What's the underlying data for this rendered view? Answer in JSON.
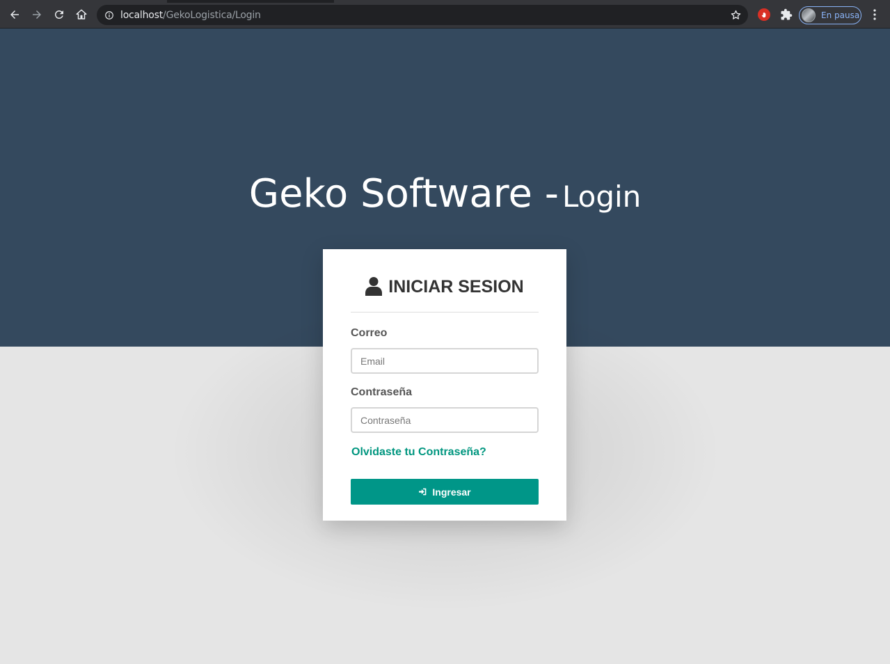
{
  "browser": {
    "url_host": "localhost",
    "url_path": "/GekoLogistica/Login",
    "profile_label": "En pausa",
    "icons": [
      "back-icon",
      "forward-icon",
      "reload-icon",
      "home-icon",
      "info-icon",
      "star-icon",
      "extension-stop-icon",
      "puzzle-icon",
      "avatar",
      "menu-icon"
    ]
  },
  "hero": {
    "title": "Geko Software -",
    "subtitle": "Login"
  },
  "login": {
    "heading": "INICIAR SESION",
    "email_label": "Correo",
    "email_placeholder": "Email",
    "password_label": "Contraseña",
    "password_placeholder": "Contraseña",
    "forgot_link": "Olvidaste tu Contraseña?",
    "submit_label": "Ingresar"
  },
  "colors": {
    "hero_bg": "#34495e",
    "page_bg": "#e5e5e5",
    "accent": "#009688"
  }
}
